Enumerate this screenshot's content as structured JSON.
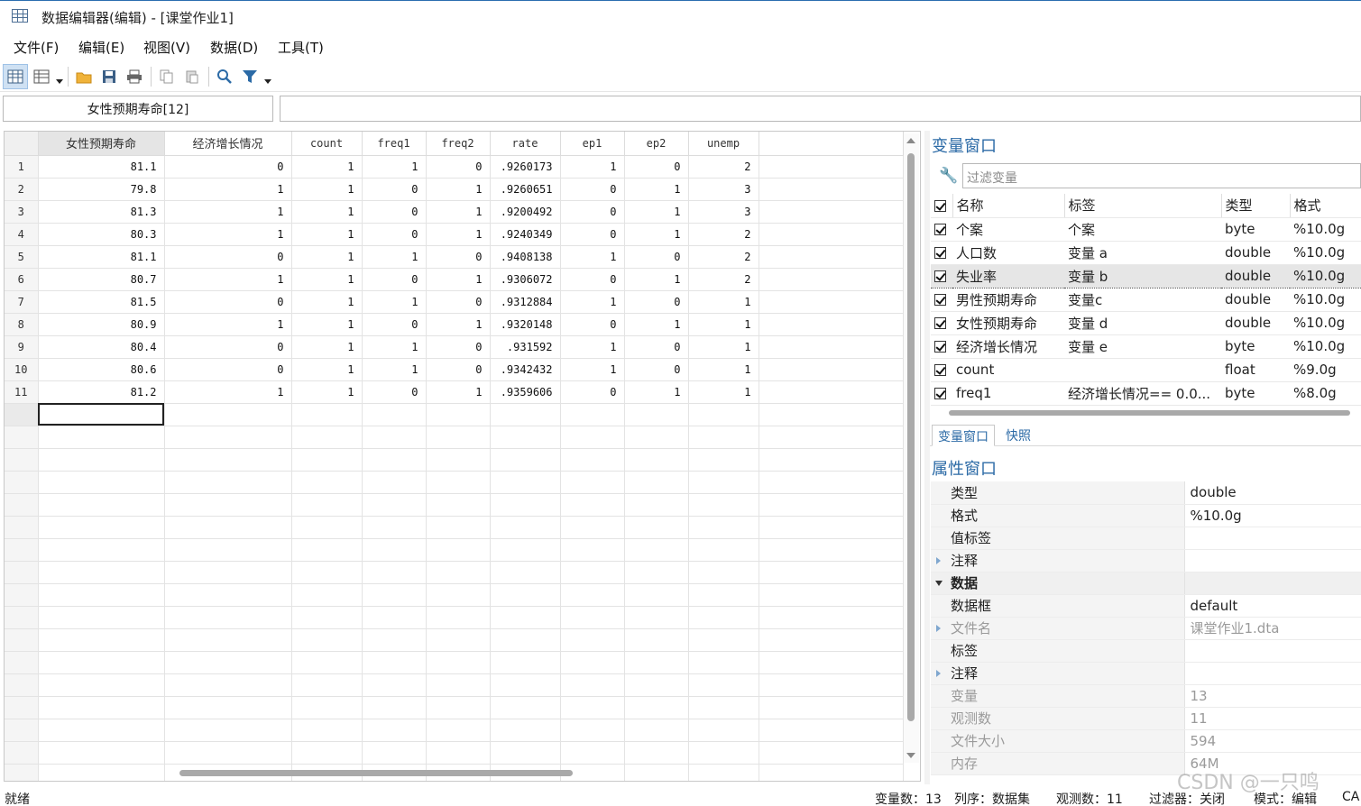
{
  "window": {
    "title": "数据编辑器(编辑) - [课堂作业1]"
  },
  "menu": [
    "文件(F)",
    "编辑(E)",
    "视图(V)",
    "数据(D)",
    "工具(T)"
  ],
  "toolbar": {
    "icons": [
      "grid-view-icon",
      "grid-options-icon",
      "open-folder-icon",
      "save-icon",
      "print-icon",
      "copy-icon",
      "paste-icon",
      "search-icon",
      "filter-icon"
    ]
  },
  "varname_box": "女性预期寿命[12]",
  "grid": {
    "columns": [
      "女性预期寿命",
      "经济增长情况",
      "count",
      "freq1",
      "freq2",
      "rate",
      "ep1",
      "ep2",
      "unemp"
    ],
    "rows": [
      [
        "1",
        "81.1",
        "0",
        "1",
        "1",
        "0",
        ".9260173",
        "1",
        "0",
        "2"
      ],
      [
        "2",
        "79.8",
        "1",
        "1",
        "0",
        "1",
        ".9260651",
        "0",
        "1",
        "3"
      ],
      [
        "3",
        "81.3",
        "1",
        "1",
        "0",
        "1",
        ".9200492",
        "0",
        "1",
        "3"
      ],
      [
        "4",
        "80.3",
        "1",
        "1",
        "0",
        "1",
        ".9240349",
        "0",
        "1",
        "2"
      ],
      [
        "5",
        "81.1",
        "0",
        "1",
        "1",
        "0",
        ".9408138",
        "1",
        "0",
        "2"
      ],
      [
        "6",
        "80.7",
        "1",
        "1",
        "0",
        "1",
        ".9306072",
        "0",
        "1",
        "2"
      ],
      [
        "7",
        "81.5",
        "0",
        "1",
        "1",
        "0",
        ".9312884",
        "1",
        "0",
        "1"
      ],
      [
        "8",
        "80.9",
        "1",
        "1",
        "0",
        "1",
        ".9320148",
        "0",
        "1",
        "1"
      ],
      [
        "9",
        "80.4",
        "0",
        "1",
        "1",
        "0",
        ".931592",
        "1",
        "0",
        "1"
      ],
      [
        "10",
        "80.6",
        "0",
        "1",
        "1",
        "0",
        ".9342432",
        "1",
        "0",
        "1"
      ],
      [
        "11",
        "81.2",
        "1",
        "1",
        "0",
        "1",
        ".9359606",
        "0",
        "1",
        "1"
      ]
    ]
  },
  "variables_pane": {
    "title": "变量窗口",
    "filter_placeholder": "过滤变量",
    "headers": {
      "name": "名称",
      "label": "标签",
      "type": "类型",
      "format": "格式"
    },
    "rows": [
      {
        "name": "个案",
        "label": "个案",
        "type": "byte",
        "format": "%10.0g"
      },
      {
        "name": "人口数",
        "label": "变量 a",
        "type": "double",
        "format": "%10.0g"
      },
      {
        "name": "失业率",
        "label": "变量 b",
        "type": "double",
        "format": "%10.0g"
      },
      {
        "name": "男性预期寿命",
        "label": "变量c",
        "type": "double",
        "format": "%10.0g"
      },
      {
        "name": "女性预期寿命",
        "label": "变量 d",
        "type": "double",
        "format": "%10.0g"
      },
      {
        "name": "经济增长情况",
        "label": "变量 e",
        "type": "byte",
        "format": "%10.0g"
      },
      {
        "name": "count",
        "label": "",
        "type": "float",
        "format": "%9.0g"
      },
      {
        "name": "freq1",
        "label": "经济增长情况== 0.0...",
        "type": "byte",
        "format": "%8.0g"
      }
    ]
  },
  "tabs": [
    "变量窗口",
    "快照"
  ],
  "properties_pane": {
    "title": "属性窗口",
    "rows": [
      {
        "key": "类型",
        "value": "double"
      },
      {
        "key": "格式",
        "value": "%10.0g"
      },
      {
        "key": "值标签",
        "value": ""
      },
      {
        "key": "注释",
        "value": ""
      },
      {
        "key": "数据",
        "value": ""
      },
      {
        "key": "数据框",
        "value": "default"
      },
      {
        "key": "文件名",
        "value": "课堂作业1.dta"
      },
      {
        "key": "标签",
        "value": ""
      },
      {
        "key": "注释",
        "value": ""
      },
      {
        "key": "变量",
        "value": "13"
      },
      {
        "key": "观测数",
        "value": "11"
      },
      {
        "key": "文件大小",
        "value": "594"
      },
      {
        "key": "内存",
        "value": "64M"
      }
    ]
  },
  "status": {
    "ready": "就绪",
    "vars": "变量数：13",
    "sort": "列序：数据集",
    "obs": "观测数：11",
    "filter": "过滤器：关闭",
    "mode": "模式：编辑",
    "caps": "CA"
  },
  "watermark": "CSDN @一只鸣"
}
